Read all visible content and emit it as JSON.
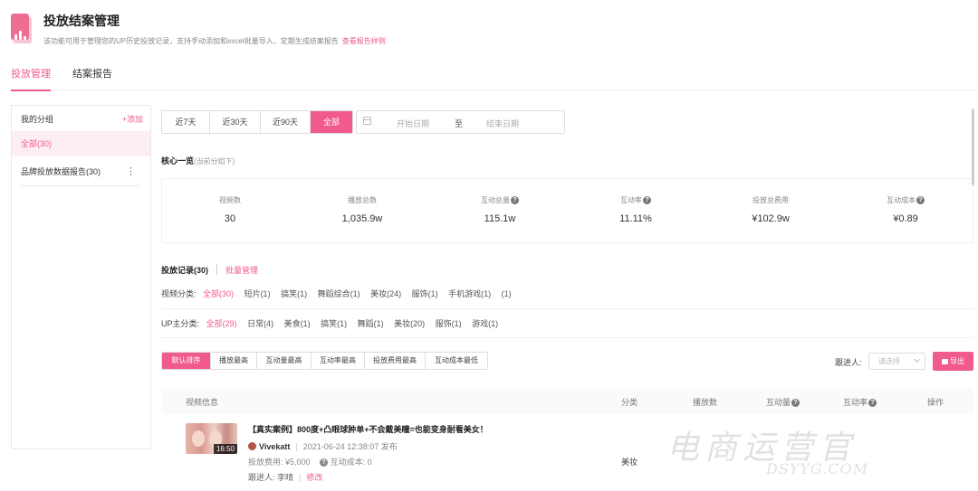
{
  "header": {
    "title": "投放结案管理",
    "subtitle": "该功能可用于管理您的UP历史投放记录，支持手动添加和excel批量导入，定期生成结案报告",
    "sample_link": "查看报告样例"
  },
  "tabs": [
    {
      "label": "投放管理",
      "active": true
    },
    {
      "label": "结案报告",
      "active": false
    }
  ],
  "sidebar": {
    "heading": "我的分组",
    "add_label": "+添加",
    "items": [
      {
        "label": "全部(30)",
        "active": true
      },
      {
        "label": "品牌投放数据报告(30)",
        "active": false
      }
    ],
    "more_icon": "⋮"
  },
  "date_filter": {
    "ranges": [
      "近7天",
      "近30天",
      "近90天",
      "全部"
    ],
    "active": "全部",
    "start_placeholder": "开始日期",
    "separator": "至",
    "end_placeholder": "结束日期"
  },
  "overview": {
    "title": "核心一览",
    "hint": "(当前分组下)",
    "stats": [
      {
        "label": "视频数",
        "value": "30",
        "help": false
      },
      {
        "label": "播放总数",
        "value": "1,035.9w",
        "help": false
      },
      {
        "label": "互动总量",
        "value": "115.1w",
        "help": true
      },
      {
        "label": "互动率",
        "value": "11.11%",
        "help": true
      },
      {
        "label": "投放总费用",
        "value": "¥102.9w",
        "help": false
      },
      {
        "label": "互动成本",
        "value": "¥0.89",
        "help": true
      }
    ]
  },
  "records": {
    "title": "投放记录(30)",
    "batch_label": "批量管理",
    "video_filter": {
      "label": "视频分类:",
      "options": [
        "全部(30)",
        "短片(1)",
        "搞笑(1)",
        "舞蹈综合(1)",
        "美妆(24)",
        "服饰(1)",
        "手机游戏(1)",
        "(1)"
      ]
    },
    "up_filter": {
      "label": "UP主分类:",
      "options": [
        "全部(29)",
        "日常(4)",
        "美食(1)",
        "搞笑(1)",
        "舞蹈(1)",
        "美妆(20)",
        "服饰(1)",
        "游戏(1)"
      ]
    },
    "sort_options": [
      "默认排序",
      "播放最高",
      "互动量最高",
      "互动率最高",
      "投放费用最高",
      "互动成本最低"
    ],
    "follower_label": "跟进人:",
    "follower_placeholder": "请选择",
    "export_label": "导出",
    "columns": {
      "video_info": "视频信息",
      "category": "分类",
      "plays": "播放数",
      "interactions": "互动量",
      "interaction_rate": "互动率",
      "actions": "操作"
    },
    "rows": [
      {
        "title": "【真实案例】800度+凸眼球肿单+不会戴美瞳=也能变身耐看美女！",
        "duration": "16:50",
        "author": "Vivekatt",
        "publish": "2021-06-24 12:38:07 发布",
        "cost": "投放费用: ¥5,000",
        "interaction_cost": "互动成本: 0",
        "follower": "跟进人: 李晴",
        "edit_label": "修改",
        "category": "美妆"
      }
    ]
  },
  "watermark": {
    "text": "电商运营官",
    "sub": "DSYYG.COM"
  },
  "colors": {
    "accent": "#f15a8c",
    "accent_light": "#fdeef3"
  }
}
